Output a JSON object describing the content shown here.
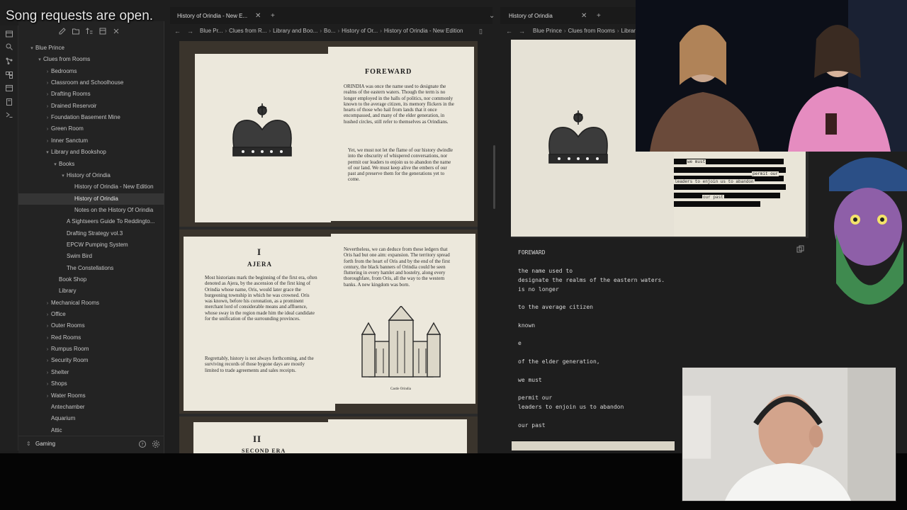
{
  "overlay": {
    "song_requests": "Song requests are open."
  },
  "sidebar": {
    "vault": "Gaming",
    "tree": [
      {
        "label": "Blue Prince",
        "depth": 0,
        "chev": "▾"
      },
      {
        "label": "Clues from Rooms",
        "depth": 1,
        "chev": "▾"
      },
      {
        "label": "Bedrooms",
        "depth": 2,
        "chev": "›"
      },
      {
        "label": "Classroom and Schoolhouse",
        "depth": 2,
        "chev": "›"
      },
      {
        "label": "Drafting Rooms",
        "depth": 2,
        "chev": "›"
      },
      {
        "label": "Drained Reservoir",
        "depth": 2,
        "chev": "›"
      },
      {
        "label": "Foundation Basement Mine",
        "depth": 2,
        "chev": "›"
      },
      {
        "label": "Green Room",
        "depth": 2,
        "chev": "›"
      },
      {
        "label": "Inner Sanctum",
        "depth": 2,
        "chev": "›"
      },
      {
        "label": "Library and Bookshop",
        "depth": 2,
        "chev": "▾"
      },
      {
        "label": "Books",
        "depth": 3,
        "chev": "▾"
      },
      {
        "label": "History of Orindia",
        "depth": 4,
        "chev": "▾"
      },
      {
        "label": "History of Orindia - New Edition",
        "depth": 5,
        "chev": ""
      },
      {
        "label": "History of Orindia",
        "depth": 5,
        "chev": "",
        "active": true
      },
      {
        "label": "Notes on the History Of Orindia",
        "depth": 5,
        "chev": ""
      },
      {
        "label": "A Sightseers Guide To Reddingto...",
        "depth": 4,
        "chev": ""
      },
      {
        "label": "Drafting Strategy vol.3",
        "depth": 4,
        "chev": ""
      },
      {
        "label": "EPCW Pumping System",
        "depth": 4,
        "chev": ""
      },
      {
        "label": "Swim Bird",
        "depth": 4,
        "chev": ""
      },
      {
        "label": "The Constellations",
        "depth": 4,
        "chev": ""
      },
      {
        "label": "Book Shop",
        "depth": 3,
        "chev": ""
      },
      {
        "label": "Library",
        "depth": 3,
        "chev": ""
      },
      {
        "label": "Mechanical Rooms",
        "depth": 2,
        "chev": "›"
      },
      {
        "label": "Office",
        "depth": 2,
        "chev": "›"
      },
      {
        "label": "Outer Rooms",
        "depth": 2,
        "chev": "›"
      },
      {
        "label": "Red Rooms",
        "depth": 2,
        "chev": "›"
      },
      {
        "label": "Rumpus Room",
        "depth": 2,
        "chev": "›"
      },
      {
        "label": "Security Room",
        "depth": 2,
        "chev": "›"
      },
      {
        "label": "Shelter",
        "depth": 2,
        "chev": "›"
      },
      {
        "label": "Shops",
        "depth": 2,
        "chev": "›"
      },
      {
        "label": "Water Rooms",
        "depth": 2,
        "chev": "›"
      },
      {
        "label": "Antechamber",
        "depth": 2,
        "chev": ""
      },
      {
        "label": "Aquarium",
        "depth": 2,
        "chev": ""
      },
      {
        "label": "Attic",
        "depth": 2,
        "chev": ""
      }
    ]
  },
  "pane_mid": {
    "tab": "History of Orindia - New E...",
    "close": "✕",
    "new_tab": "+",
    "dropdown": "⌄",
    "crumbs": [
      "Blue Pr...",
      "Clues from R...",
      "Library and Boo...",
      "Bo...",
      "History of Or...",
      "History of Orindia - New Edition"
    ],
    "book": {
      "foreward_title": "FOREWARD",
      "foreward_p1": "ORINDIA was once the name used to designate the realms of the eastern waters. Though the term is no longer employed in the halls of politics, nor commonly known to the average citizen, its memory flickers in the hearts of those who hail from lands that it once encompassed, and many of the elder generation, in hushed circles, still refer to themselves as Orindians.",
      "foreward_p2": "Yet, we must not let the flame of our history dwindle into the obscurity of whispered conversations, nor permit our leaders to enjoin us to abandon the name of our land. We must keep alive the embers of our past and preserve them for the generations yet to come.",
      "ch1_num": "I",
      "ch1_title": "AJERA",
      "ch1_p1": "Most historians mark the beginning of the first era, often denoted as Ajera, by the ascension of the first king of Orindia whose name, Oris, would later grace the burgeoning township in which he was crowned. Oris was known, before his coronation, as a prominent merchant lord of considerable means and affluence, whose sway in the region made him the ideal candidate for the unification of the surrounding provinces.",
      "ch1_p2": "Regrettably, history is not always forthcoming, and the surviving records of those bygone days are mostly limited to trade agreements and sales receipts.",
      "ch1_right": "Nevertheless, we can deduce from these ledgers that Oris had but one aim: expansion. The territory spread forth from the heart of Oris and by the end of the first century, the black banners of Orindia could be seen fluttering in every hamlet and hostelry, along every thoroughfare, from Oris, all the way to the western banks. A new kingdom was born.",
      "castle_caption": "Castle Orindia",
      "ch2_num": "II",
      "ch2_title": "SECOND ERA"
    }
  },
  "pane_right": {
    "tab": "History of Orindia",
    "close": "✕",
    "new_tab": "+",
    "crumbs": [
      "Blue Prince",
      "Clues from Rooms",
      "Library"
    ],
    "redacted_words": [
      "we must",
      "permit our",
      "leaders to enjoin us to abandon",
      "our past"
    ],
    "note_lines": [
      "FOREWARD",
      "the name used to",
      "designate the realms of the eastern waters.",
      "is no longer",
      "to the average citizen",
      "known",
      "e",
      "of the elder generation,",
      "we must",
      "permit our",
      "leaders to enjoin us to abandon",
      "our past"
    ]
  },
  "colors": {
    "app_bg": "#1e1e1e",
    "sidebar_bg": "#232323",
    "active_row": "#353535",
    "page": "#ece8dc"
  }
}
